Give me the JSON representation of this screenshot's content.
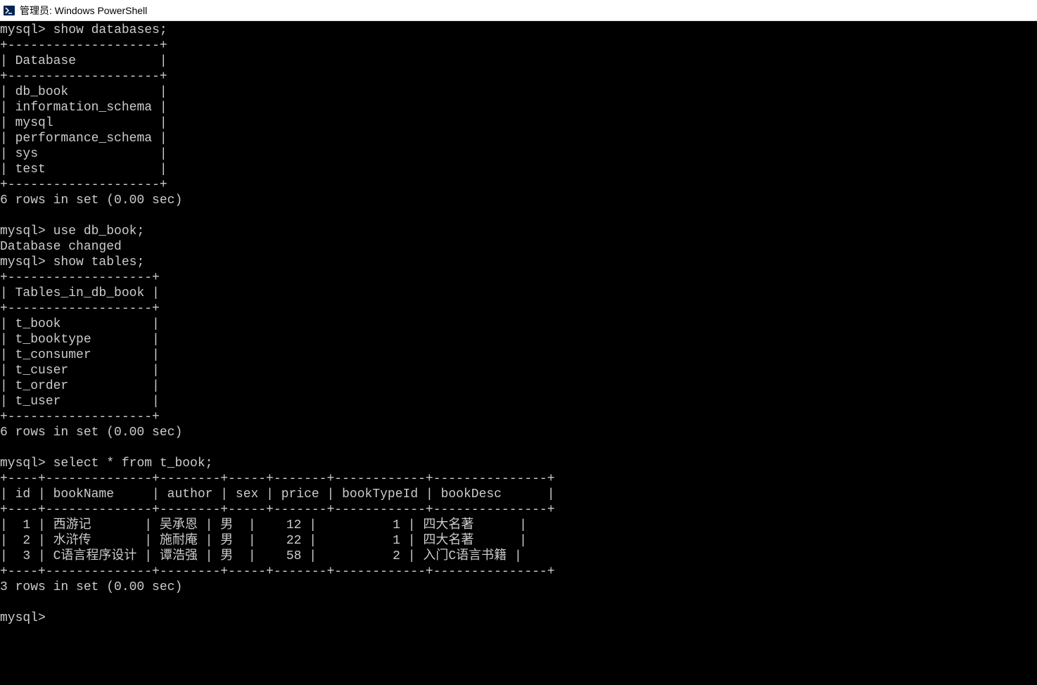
{
  "window": {
    "title": "管理员: Windows PowerShell"
  },
  "session": {
    "prompt": "mysql>",
    "cmd1": "show databases;",
    "db_header": "Database",
    "db_border_top": "+--------------------+",
    "db_border_mid": "+--------------------+",
    "db_border_bot": "+--------------------+",
    "databases": {
      "d0": "db_book",
      "d1": "information_schema",
      "d2": "mysql",
      "d3": "performance_schema",
      "d4": "sys",
      "d5": "test"
    },
    "db_rows_msg": "6 rows in set (0.00 sec)",
    "cmd2": "use db_book;",
    "db_changed": "Database changed",
    "cmd3": "show tables;",
    "tables_header": "Tables_in_db_book",
    "tables_border": "+-------------------+",
    "tables": {
      "t0": "t_book",
      "t1": "t_booktype",
      "t2": "t_consumer",
      "t3": "t_cuser",
      "t4": "t_order",
      "t5": "t_user"
    },
    "tables_rows_msg": "6 rows in set (0.00 sec)",
    "cmd4": "select * from t_book;",
    "book_border": "+----+--------------+--------+-----+-------+------------+---------------+",
    "book_headers": {
      "h0": "id",
      "h1": "bookName",
      "h2": "author",
      "h3": "sex",
      "h4": "price",
      "h5": "bookTypeId",
      "h6": "bookDesc"
    },
    "book_rows": {
      "r0": {
        "id": "1",
        "bookName": "西游记",
        "author": "吴承恩",
        "sex": "男",
        "price": "12",
        "bookTypeId": "1",
        "bookDesc": "四大名著"
      },
      "r1": {
        "id": "2",
        "bookName": "水浒传",
        "author": "施耐庵",
        "sex": "男",
        "price": "22",
        "bookTypeId": "1",
        "bookDesc": "四大名著"
      },
      "r2": {
        "id": "3",
        "bookName": "C语言程序设计",
        "author": "谭浩强",
        "sex": "男",
        "price": "58",
        "bookTypeId": "2",
        "bookDesc": "入门C语言书籍"
      }
    },
    "book_rows_msg": "3 rows in set (0.00 sec)"
  }
}
